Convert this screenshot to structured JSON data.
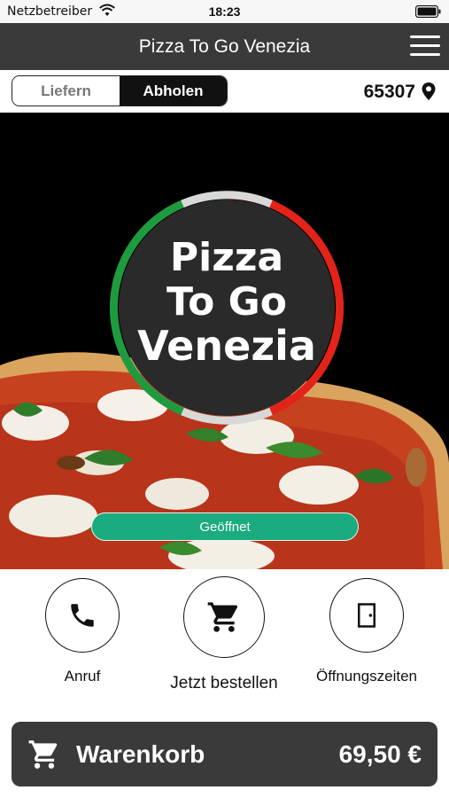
{
  "status_bar": {
    "carrier": "Netzbetreiber",
    "time": "18:23"
  },
  "header": {
    "title": "Pizza To Go Venezia"
  },
  "mode_toggle": {
    "delivery": "Liefern",
    "pickup": "Abholen",
    "selected": "Abholen"
  },
  "location": {
    "zip": "65307"
  },
  "hero": {
    "logo": {
      "line1": "Pizza",
      "line2": "To Go",
      "line3": "Venezia"
    },
    "status_button": "Geöffnet"
  },
  "actions": [
    {
      "label": "Anruf",
      "icon": "phone-icon"
    },
    {
      "label": "Jetzt bestellen",
      "icon": "cart-icon"
    },
    {
      "label": "Öffnungszeiten",
      "icon": "door-icon"
    }
  ],
  "cart": {
    "label": "Warenkorb",
    "total": "69,50 €",
    "icon": "cart-icon"
  },
  "colors": {
    "header_bg": "#3a3a3a",
    "accent_green": "#1aab7e",
    "flag_green": "#1f9b3f",
    "flag_white": "#d8d8d8",
    "flag_red": "#e2231a"
  }
}
